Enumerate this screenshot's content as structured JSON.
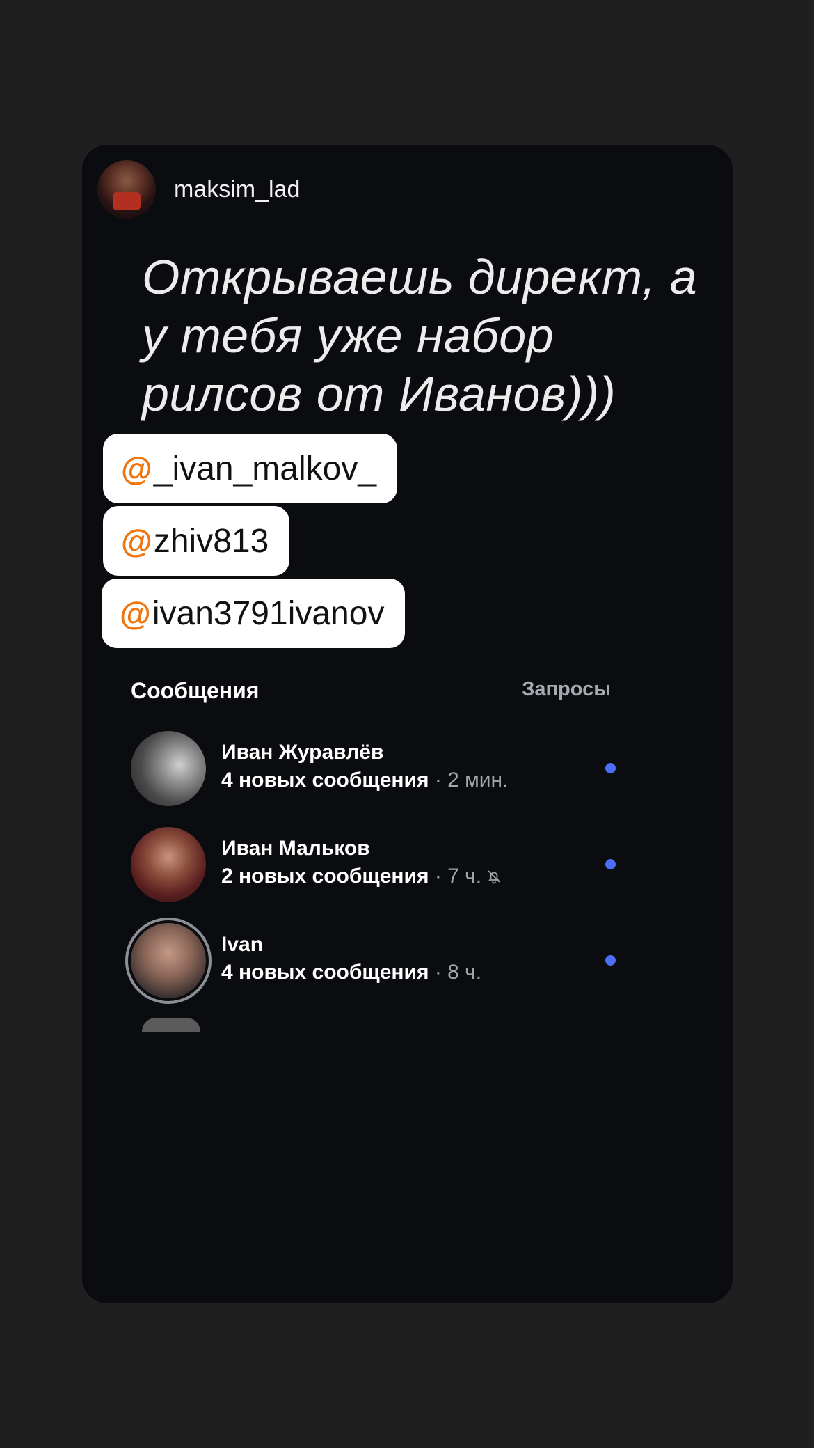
{
  "author": {
    "name": "maksim_lad"
  },
  "headline": "Открываешь директ, а у тебя уже набор рилсов от Иванов)))",
  "mentions": [
    {
      "at": "@",
      "handle": "_ivan_malkov_"
    },
    {
      "at": "@",
      "handle": "zhiv813"
    },
    {
      "at": "@",
      "handle": "ivan3791ivanov"
    }
  ],
  "mention_icon": "threads-at-icon",
  "colors": {
    "accent_orange": "#f0750f",
    "unread_dot": "#4c6ef5",
    "card_bg": "#0b0c10",
    "page_bg": "#1f1f1f"
  },
  "inbox": {
    "title": "Сообщения",
    "requests_label": "Запросы",
    "threads": [
      {
        "name": "Иван Журавлёв",
        "count": "4 новых сообщения",
        "time": " · 2 мин.",
        "muted": false,
        "unread": true
      },
      {
        "name": "Иван Мальков",
        "count": "2 новых сообщения",
        "time": " · 7 ч.",
        "muted": true,
        "unread": true
      },
      {
        "name": "Ivan",
        "count": "4 новых сообщения",
        "time": " · 8 ч.",
        "muted": false,
        "unread": true
      }
    ]
  }
}
